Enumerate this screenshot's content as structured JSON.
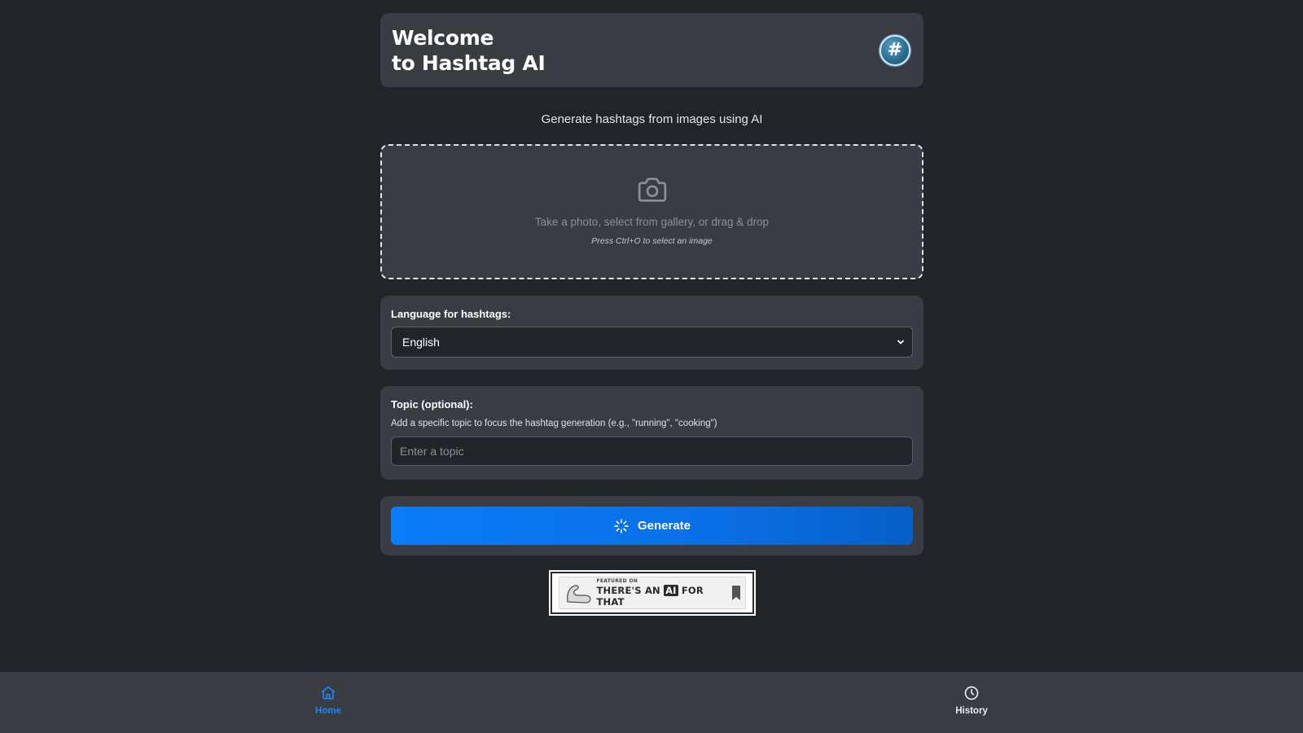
{
  "header": {
    "title_line1": "Welcome",
    "title_line2": "to Hashtag AI",
    "logo_glyph": "#"
  },
  "subtitle": "Generate hashtags from images using AI",
  "upload": {
    "icon": "camera-icon",
    "instruction": "Take a photo, select from gallery, or drag & drop",
    "shortcut_hint": "Press Ctrl+O to select an image"
  },
  "language": {
    "label": "Language for hashtags:",
    "selected": "English"
  },
  "topic": {
    "label": "Topic (optional):",
    "help": "Add a specific topic to focus the hashtag generation (e.g., \"running\", \"cooking\")",
    "placeholder": "Enter a topic",
    "value": ""
  },
  "generate": {
    "label": "Generate",
    "icon": "spinner-icon",
    "color": "#0a7cf8"
  },
  "badge": {
    "small_text": "FEATURED ON",
    "big_text_before": "THERE'S AN ",
    "big_text_ai": "AI",
    "big_text_after": " FOR THAT"
  },
  "nav": {
    "items": [
      {
        "label": "Home",
        "icon": "home-icon",
        "active": true
      },
      {
        "label": "History",
        "icon": "clock-icon",
        "active": false
      }
    ],
    "active_color": "#1e88f0"
  },
  "colors": {
    "background": "#212429",
    "card": "#393c43",
    "accent": "#0a7cf8"
  }
}
